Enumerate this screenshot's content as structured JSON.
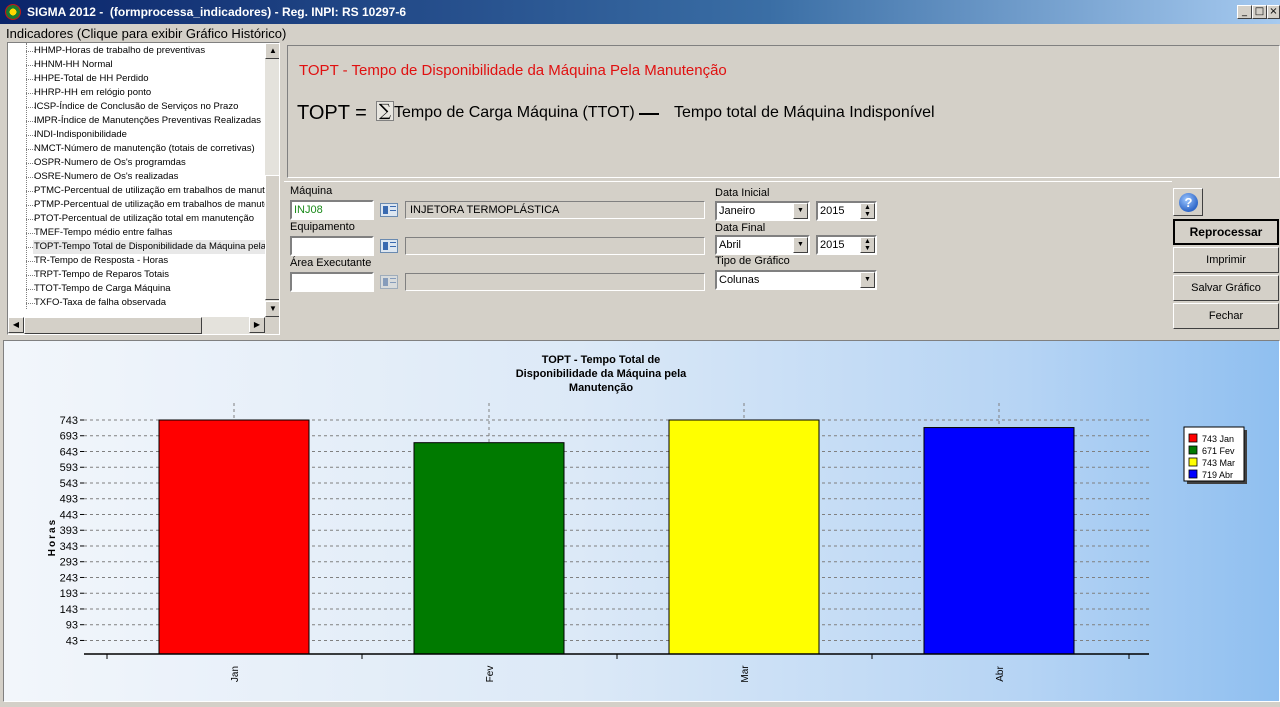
{
  "window": {
    "title": "SIGMA 2012 -  (formprocessa_indicadores) - Reg. INPI: RS 10297-6",
    "minimize": "_",
    "maximize": "□",
    "close": "×"
  },
  "sidebar": {
    "header": "Indicadores (Clique para exibir Gráfico Histórico)",
    "items": [
      "HHMP-Horas de trabalho de preventivas",
      "HHNM-HH Normal",
      "HHPE-Total de HH Perdido",
      "HHRP-HH em relógio ponto",
      "ICSP-Índice de Conclusão de Serviços no Prazo",
      "IMPR-Índice de Manutenções Preventivas Realizadas",
      "INDI-Indisponibilidade",
      "NMCT-Número de manutenção (totais de corretivas)",
      "OSPR-Numero de Os's programdas",
      "OSRE-Numero de Os's realizadas",
      "PTMC-Percentual de utilização em trabalhos de manutenção corretiva",
      "PTMP-Percentual de utilização em trabalhos de manutenção preventiva",
      "PTOT-Percentual de utilização total em manutenção",
      "TMEF-Tempo médio entre falhas",
      "TOPT-Tempo Total de Disponibilidade da Máquina pela Manutenção",
      "TR-Tempo de Resposta - Horas",
      "TRPT-Tempo de Reparos Totais",
      "TTOT-Tempo de Carga Máquina",
      "TXFO-Taxa de falha observada"
    ],
    "selected_index": 14
  },
  "formula": {
    "title": "TOPT - Tempo de Disponibilidade da Máquina Pela Manutenção",
    "lhs": "TOPT =",
    "sigma": "∑",
    "term1": "Tempo de Carga Máquina (TTOT)",
    "term2": "Tempo total de Máquina Indisponível"
  },
  "filters": {
    "maquina_label": "Máquina",
    "maquina_code": "INJ08",
    "maquina_desc": "INJETORA TERMOPLÁSTICA",
    "equipamento_label": "Equipamento",
    "equipamento_code": "",
    "equipamento_desc": "",
    "area_label": "Área Executante",
    "area_code": "",
    "area_desc": "",
    "data_inicial_label": "Data Inicial",
    "data_inicial_mes": "Janeiro",
    "data_inicial_ano": "2015",
    "data_final_label": "Data Final",
    "data_final_mes": "Abril",
    "data_final_ano": "2015",
    "tipo_grafico_label": "Tipo de Gráfico",
    "tipo_grafico": "Colunas"
  },
  "buttons": {
    "help": "?",
    "reprocessar": "Reprocessar",
    "imprimir": "Imprimir",
    "salvar": "Salvar Gráfico",
    "fechar": "Fechar"
  },
  "chart_data": {
    "type": "bar",
    "title_lines": [
      "TOPT - Tempo Total de",
      "Disponibilidade da Máquina pela",
      "Manutenção"
    ],
    "ylabel": "Horas",
    "categories": [
      "Jan",
      "Fev",
      "Mar",
      "Abr"
    ],
    "values": [
      743,
      671,
      743,
      719
    ],
    "colors": [
      "#ff0000",
      "#007a00",
      "#ffff00",
      "#0000ff"
    ],
    "yticks": [
      43,
      93,
      143,
      193,
      243,
      293,
      343,
      393,
      443,
      493,
      543,
      593,
      643,
      693,
      743
    ],
    "ylim": [
      0,
      743
    ],
    "grid": true,
    "legend": [
      "743 Jan",
      "671 Fev",
      "743 Mar",
      "719 Abr"
    ],
    "legend_position": "right"
  }
}
